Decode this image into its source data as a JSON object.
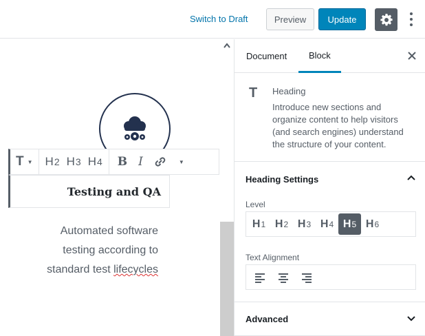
{
  "topbar": {
    "switch_draft": "Switch to Draft",
    "preview": "Preview",
    "update": "Update",
    "settings_icon": "gear-icon",
    "more_icon": "vertical-ellipsis-icon"
  },
  "editor": {
    "toolbar": {
      "paragraph_icon": "T",
      "levels": [
        {
          "label": "H",
          "num": "2"
        },
        {
          "label": "H",
          "num": "3"
        },
        {
          "label": "H",
          "num": "4"
        }
      ],
      "bold": "B",
      "italic": "I"
    },
    "heading": "Testing and QA",
    "paragraph": {
      "line1": "Automated software",
      "line2": "testing according to",
      "line3_pre": "standard test ",
      "line3_err": "lifecycles"
    }
  },
  "sidebar": {
    "tabs": [
      {
        "label": "Document",
        "active": false
      },
      {
        "label": "Block",
        "active": true
      }
    ],
    "block": {
      "icon": "T",
      "title": "Heading",
      "description": "Introduce new sections and organize content to help visitors (and search engines) understand the structure of your content."
    },
    "heading_settings": {
      "title": "Heading Settings",
      "level_label": "Level",
      "levels": [
        {
          "label": "H",
          "num": "1"
        },
        {
          "label": "H",
          "num": "2"
        },
        {
          "label": "H",
          "num": "3"
        },
        {
          "label": "H",
          "num": "4"
        },
        {
          "label": "H",
          "num": "5"
        },
        {
          "label": "H",
          "num": "6"
        }
      ],
      "active_level": "5",
      "alignment_label": "Text Alignment"
    },
    "advanced": {
      "title": "Advanced"
    }
  },
  "colors": {
    "accent": "#0085ba",
    "link": "#0073aa",
    "dark": "#555d66",
    "logo": "#23314e",
    "error_underline": "#dc3232"
  }
}
